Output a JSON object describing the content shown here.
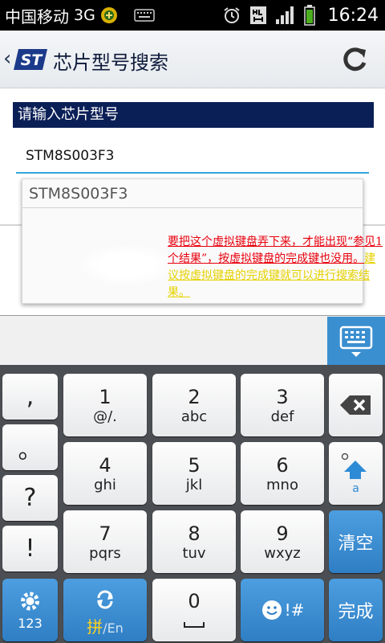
{
  "status_bar": {
    "carrier": "中国移动",
    "network": "3G",
    "time": "16:24"
  },
  "app_bar": {
    "title": "芯片型号搜索",
    "logo_text": "ST"
  },
  "search": {
    "label": "请输入芯片型号",
    "value": "STM8S003F3"
  },
  "suggestions": {
    "items": [
      "STM8S003F3"
    ]
  },
  "annotation": {
    "red_text": "要把这个虚拟键盘弄下来，才能出现“参见1个结果”，按虚拟键盘的完成键也没用。",
    "yellow_text": "建议按虚拟键盘的完成键就可以进行搜索结果。"
  },
  "keyboard": {
    "punct_keys": [
      ",",
      "。",
      "?",
      "!"
    ],
    "num_keys": [
      {
        "main": "1",
        "sub": "@/."
      },
      {
        "main": "2",
        "sub": "abc"
      },
      {
        "main": "3",
        "sub": "def"
      },
      {
        "main": "4",
        "sub": "ghi"
      },
      {
        "main": "5",
        "sub": "jkl"
      },
      {
        "main": "6",
        "sub": "mno"
      },
      {
        "main": "7",
        "sub": "pqrs"
      },
      {
        "main": "8",
        "sub": "tuv"
      },
      {
        "main": "9",
        "sub": "wxyz"
      }
    ],
    "zero_key": "0",
    "shift_sub": "a",
    "clear_label": "清空",
    "done_label": "完成",
    "mode_123": "123",
    "lang_pinyin": "拼",
    "lang_sep": "/",
    "lang_en": "En",
    "emoji_suffix": "!#",
    "accent_color": "#3a8fd0"
  }
}
